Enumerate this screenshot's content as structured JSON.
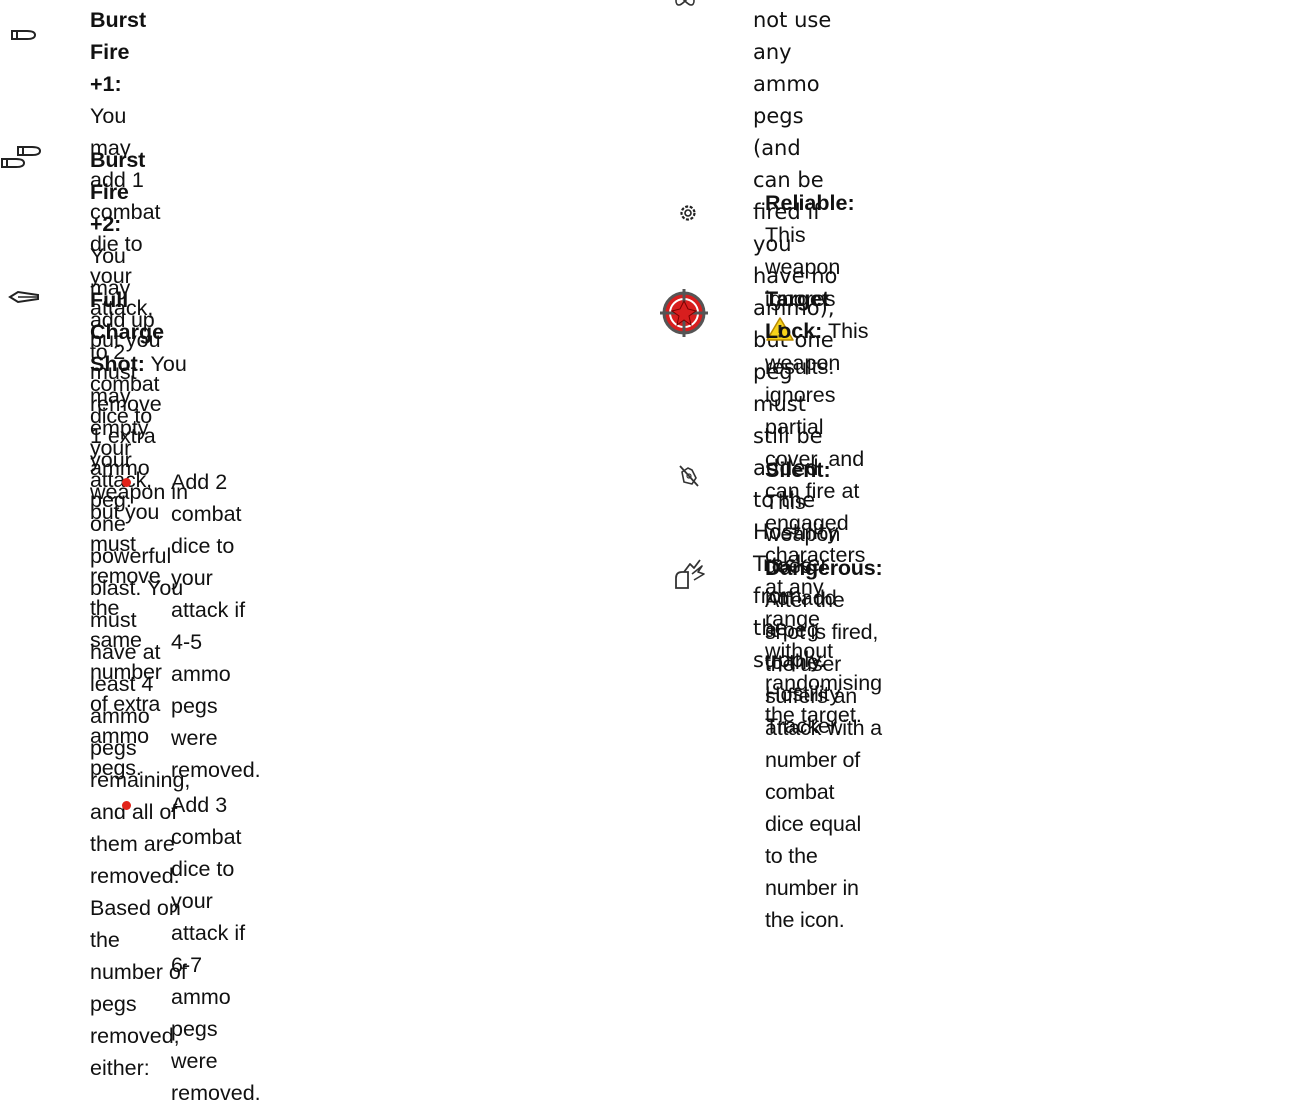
{
  "left": {
    "entries": [
      {
        "icon": "bullet-icon",
        "title": "Burst Fire +1:",
        "lines": [
          "You may add 1 combat",
          "die to your attack, but you must remove",
          "1 extra ammo peg."
        ]
      },
      {
        "icon": "double-bullet-icon",
        "title": "Burst Fire +2:",
        "lines": [
          "You may add up to 2 combat",
          "dice to your attack, but you must remove",
          "the same number of extra ammo pegs."
        ]
      },
      {
        "icon": "charge-shot-icon",
        "title": "Full Charge Shot:",
        "lines": [
          "You may empty your",
          "weapon in one powerful blast. You must",
          "have at least 4 ammo pegs remaining,",
          "and all of them are removed. Based on",
          "the number of pegs removed, either:"
        ],
        "bullets": [
          {
            "l1": "Add 2 combat dice to your attack if",
            "l2": "4-5 ammo pegs were removed."
          },
          {
            "l1": "Add 3 combat dice to your attack if",
            "l2": "6-7 ammo pegs were removed."
          }
        ]
      }
    ]
  },
  "right": {
    "cut_entry": {
      "icon": "infinity-icon",
      "lines": [
        "not use any ammo pegs (and can be",
        "fired if you have no ammo), but one",
        "peg must still be added to the Hostility",
        "Tracker from the supply."
      ]
    },
    "entries": [
      {
        "icon": "gear-icon",
        "title": "Reliable:",
        "line1": "This weapon ignores",
        "line2": "results."
      },
      {
        "icon": "target-lock-icon",
        "title": "Target Lock:",
        "lines": [
          "This weapon ignores",
          "partial cover, and can fire at engaged",
          "characters at any range without",
          "randomising the target."
        ]
      },
      {
        "icon": "silent-icon",
        "title": "Silent:",
        "lines": [
          "This weapon does not add a peg",
          "to the Hostility Tracker."
        ]
      },
      {
        "icon": "dangerous-icon",
        "title": "Dangerous:",
        "lines": [
          "After the shot is fired, the user",
          "suffers an attack with a number of combat",
          "dice equal to the number in the icon."
        ]
      }
    ]
  },
  "colors": {
    "text": "#111111",
    "bullet_dot": "#e2231a",
    "warning_fill": "#f7d31a",
    "target_red": "#d81e1e"
  }
}
